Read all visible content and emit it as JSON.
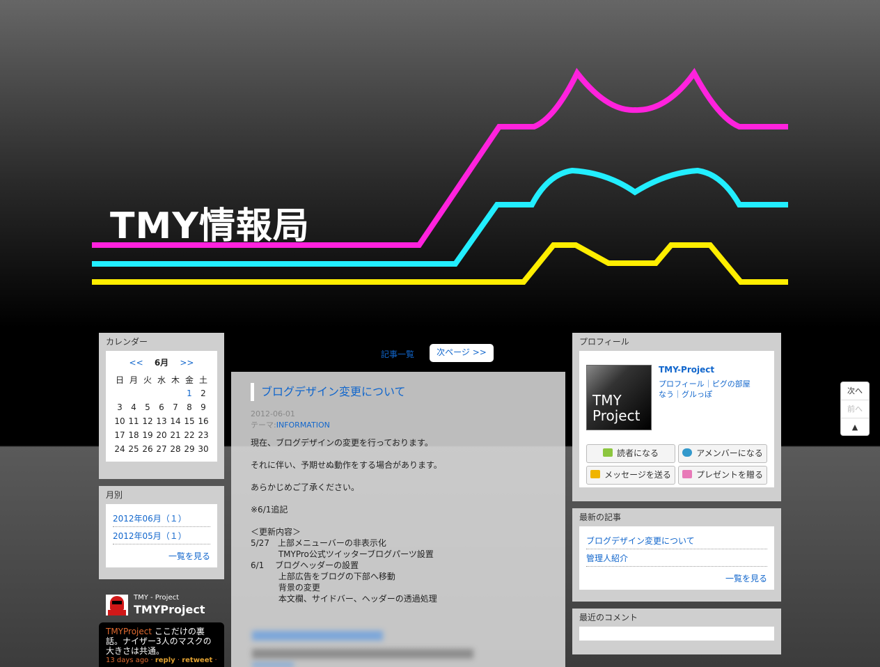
{
  "header": {
    "title": "TMY情報局",
    "colors": {
      "magenta": "#ff22dd",
      "cyan": "#22eeff",
      "yellow": "#ffee00"
    }
  },
  "calendar": {
    "title": "カレンダー",
    "prev": "<<",
    "next": ">>",
    "month": "6月",
    "weekdays": [
      "日",
      "月",
      "火",
      "水",
      "木",
      "金",
      "土"
    ],
    "weeks": [
      [
        "",
        "",
        "",
        "",
        "",
        "1",
        "2"
      ],
      [
        "3",
        "4",
        "5",
        "6",
        "7",
        "8",
        "9"
      ],
      [
        "10",
        "11",
        "12",
        "13",
        "14",
        "15",
        "16"
      ],
      [
        "17",
        "18",
        "19",
        "20",
        "21",
        "22",
        "23"
      ],
      [
        "24",
        "25",
        "26",
        "27",
        "28",
        "29",
        "30"
      ]
    ],
    "linked_days": [
      "1"
    ]
  },
  "monthly": {
    "title": "月別",
    "items": [
      "2012年06月（１）",
      "2012年05月（１）"
    ],
    "more": "一覧を見る"
  },
  "twitter": {
    "user": "TMY - Project",
    "handle": "TMYProject",
    "tweet_user": "TMYProject",
    "tweet_text": "ここだけの裏話。ナイザー3人のマスクの大きさは共通。",
    "time": "13 days ago",
    "reply": "reply",
    "retweet": "retweet"
  },
  "pager": {
    "list": "記事一覧",
    "next": "次ページ >>"
  },
  "article": {
    "title": "ブログデザイン変更について",
    "date": "2012-06-01",
    "theme_label": "テーマ:",
    "theme": "INFORMATION",
    "lines": [
      "現在、ブログデザインの変更を行っております。",
      "",
      "それに伴い、予期せぬ動作をする場合があります。",
      "",
      "あらかじめご了承ください。",
      "",
      "※6/1追記",
      "",
      "＜更新内容＞",
      "5/27　上部メニューバーの非表示化",
      "　　　 TMYPro公式ツイッターブログパーツ設置",
      "6/1　  ブログヘッダーの設置",
      "　　　 上部広告をブログの下部へ移動",
      "　　　 背景の変更",
      "　　　 本文欄、サイドバー、ヘッダーの透過処理"
    ]
  },
  "profile": {
    "title": "プロフィール",
    "image_text": [
      "TMY",
      "Project"
    ],
    "name": "TMY-Project",
    "links_line1": "プロフィール｜ピグの部屋",
    "links_line2": "なう｜グルっぽ",
    "buttons": {
      "reader": "読者になる",
      "member": "アメンバーになる",
      "message": "メッセージを送る",
      "present": "プレゼントを贈る"
    },
    "button_icon_colors": {
      "reader": "#8cc63f",
      "member": "#3399cc",
      "message": "#f0b400",
      "present": "#e87ab8"
    }
  },
  "recent": {
    "title": "最新の記事",
    "items": [
      "ブログデザイン変更について",
      "管理人紹介"
    ],
    "more": "一覧を見る"
  },
  "comments": {
    "title": "最近のコメント"
  },
  "scroll_nav": {
    "next": "次へ",
    "prev": "前へ",
    "top": "▲"
  }
}
